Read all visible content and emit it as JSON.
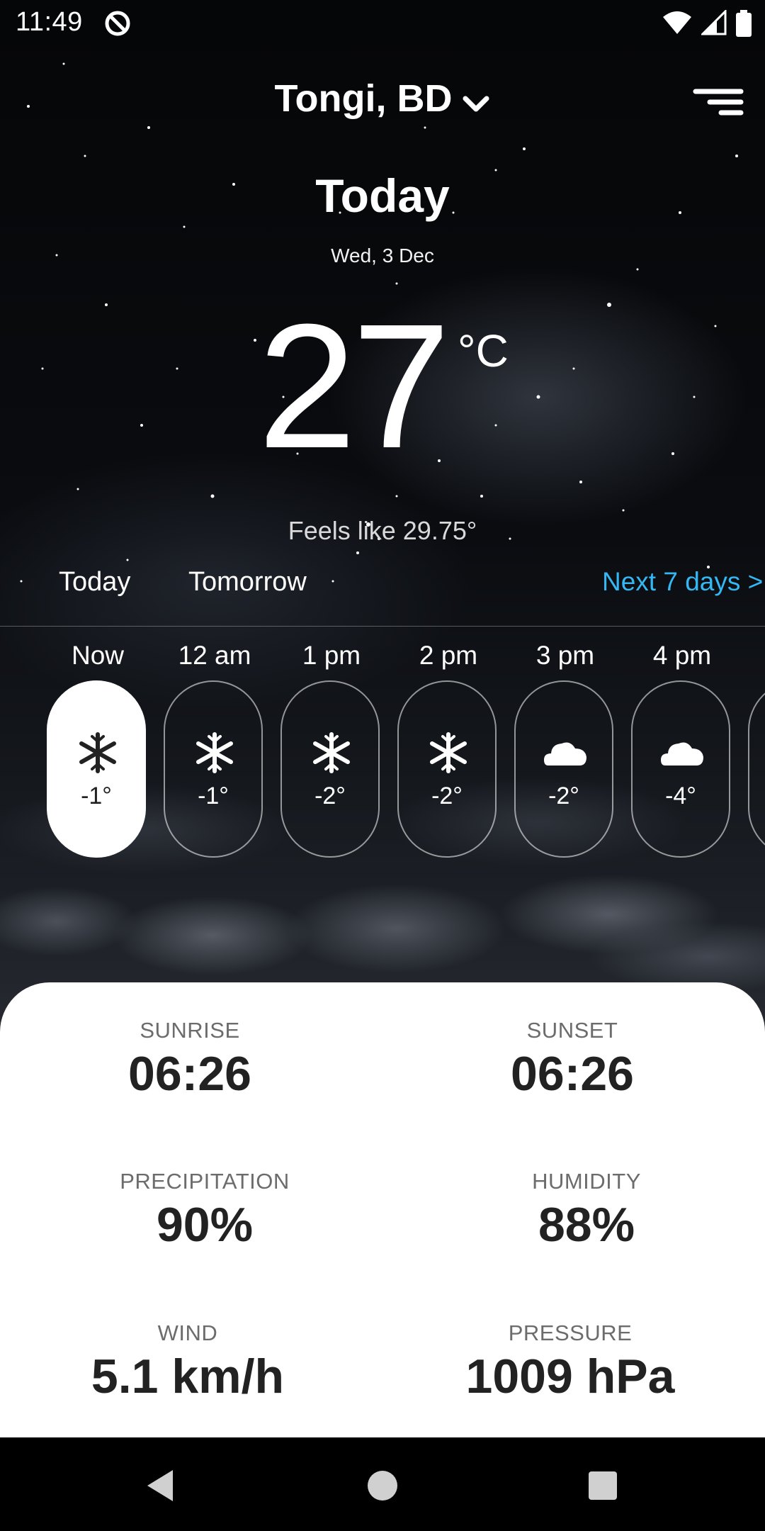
{
  "status_bar": {
    "time": "11:49",
    "icons": [
      "app-status-icon",
      "wifi-icon",
      "signal-icon",
      "battery-icon"
    ]
  },
  "header": {
    "location": "Tongi, BD",
    "location_icon": "chevron-down-icon",
    "menu_icon": "menu-icon"
  },
  "current": {
    "title": "Today",
    "date": "Wed, 3 Dec",
    "temperature": "27",
    "unit": "°C",
    "feels_like": "Feels like 29.75°"
  },
  "tabs": {
    "today": "Today",
    "tomorrow": "Tomorrow",
    "next_days": "Next 7 days >"
  },
  "hourly": [
    {
      "time": "Now",
      "temp": "-1°",
      "icon": "snowflake-icon",
      "active": true
    },
    {
      "time": "12 am",
      "temp": "-1°",
      "icon": "snowflake-icon",
      "active": false
    },
    {
      "time": "1 pm",
      "temp": "-2°",
      "icon": "snowflake-icon",
      "active": false
    },
    {
      "time": "2 pm",
      "temp": "-2°",
      "icon": "snowflake-icon",
      "active": false
    },
    {
      "time": "3 pm",
      "temp": "-2°",
      "icon": "cloud-icon",
      "active": false
    },
    {
      "time": "4 pm",
      "temp": "-4°",
      "icon": "cloud-icon",
      "active": false
    }
  ],
  "details": {
    "sunrise": {
      "label": "SUNRISE",
      "value": "06:26"
    },
    "sunset": {
      "label": "SUNSET",
      "value": "06:26"
    },
    "precipitation": {
      "label": "PRECIPITATION",
      "value": "90%"
    },
    "humidity": {
      "label": "HUMIDITY",
      "value": "88%"
    },
    "wind": {
      "label": "WIND",
      "value": "5.1 km/h"
    },
    "pressure": {
      "label": "PRESSURE",
      "value": "1009 hPa"
    }
  },
  "colors": {
    "accent": "#35b7f3",
    "panel": "#ffffff",
    "label": "#6c6c6c",
    "value": "#222222"
  },
  "nav_bar": [
    "back-icon",
    "home-icon",
    "recents-icon"
  ]
}
